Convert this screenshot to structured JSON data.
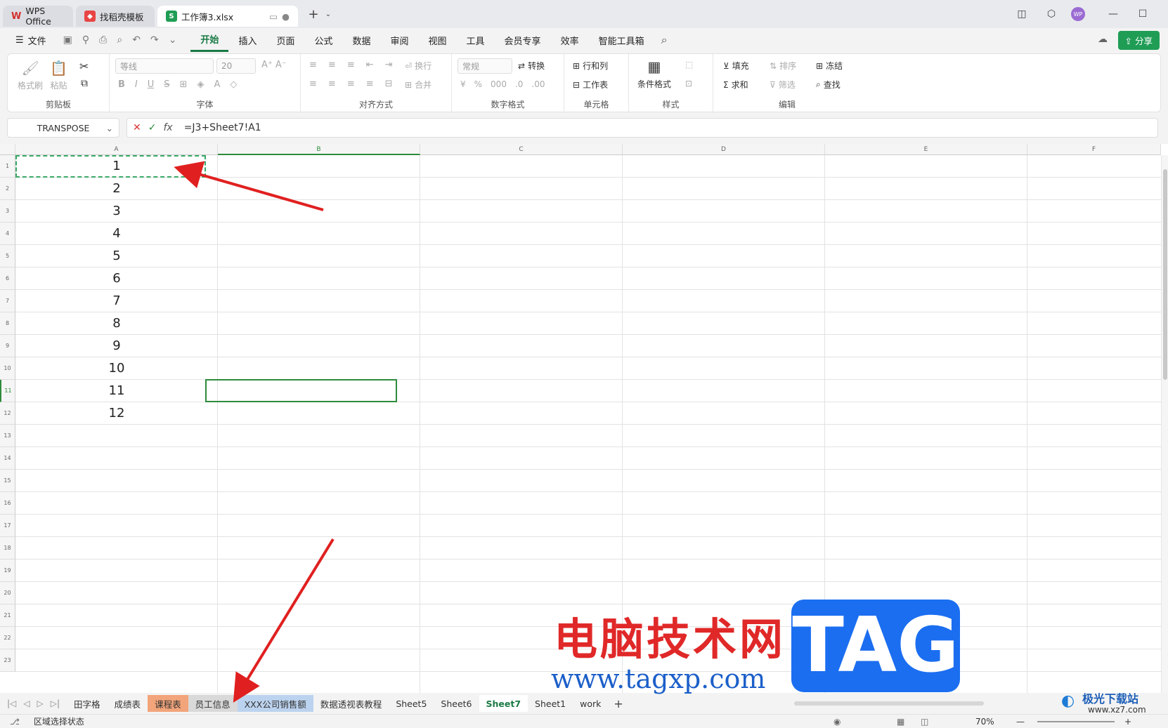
{
  "titlebar": {
    "tabs": [
      {
        "label": "WPS Office",
        "active": false
      },
      {
        "label": "找稻壳模板",
        "active": false
      },
      {
        "label": "工作簿3.xlsx",
        "active": true
      }
    ],
    "new_tab": "+"
  },
  "menu": {
    "file": "文件",
    "items": [
      "开始",
      "插入",
      "页面",
      "公式",
      "数据",
      "审阅",
      "视图",
      "工具",
      "会员专享",
      "效率",
      "智能工具箱"
    ],
    "active": "开始",
    "share": "分享"
  },
  "ribbon": {
    "clipboard": {
      "label": "剪贴板",
      "format_painter": "格式刷",
      "paste": "粘贴"
    },
    "font": {
      "label": "字体",
      "font_name": "等线",
      "font_size": "20"
    },
    "align": {
      "label": "对齐方式",
      "wrap": "换行",
      "merge": "合并"
    },
    "number": {
      "label": "数字格式",
      "format": "常规",
      "convert": "转换"
    },
    "cells": {
      "label": "单元格",
      "rowcol": "行和列",
      "sheet": "工作表"
    },
    "styles": {
      "label": "样式",
      "cond_format": "条件格式"
    },
    "edit": {
      "label": "编辑",
      "fill": "填充",
      "sort": "排序",
      "freeze": "冻结",
      "sum": "求和",
      "filter": "筛选",
      "find": "查找"
    }
  },
  "formula_bar": {
    "name_box": "TRANSPOSE",
    "fx": "fx",
    "formula": "=J3+Sheet7!A1"
  },
  "grid": {
    "columns": [
      "A",
      "B",
      "C",
      "D",
      "E",
      "F"
    ],
    "rows": [
      "1",
      "2",
      "3",
      "4",
      "5",
      "6",
      "7",
      "8",
      "9",
      "10",
      "11",
      "12",
      "13",
      "14",
      "15",
      "16",
      "17",
      "18",
      "19",
      "20",
      "21",
      "22",
      "23"
    ],
    "column_a_values": [
      "1",
      "2",
      "3",
      "4",
      "5",
      "6",
      "7",
      "8",
      "9",
      "10",
      "11",
      "12"
    ],
    "active_cell": "B11",
    "accent": "#2e8b3c"
  },
  "sheets": {
    "tabs": [
      {
        "label": "田字格"
      },
      {
        "label": "成绩表"
      },
      {
        "label": "课程表",
        "color": "#f2a47a"
      },
      {
        "label": "员工信息",
        "color": "#d9d9d9"
      },
      {
        "label": "XXX公司销售额",
        "color": "#bcd3ef"
      },
      {
        "label": "数据透视表教程"
      },
      {
        "label": "Sheet5"
      },
      {
        "label": "Sheet6"
      },
      {
        "label": "Sheet7",
        "active": true
      },
      {
        "label": "Sheet1"
      },
      {
        "label": "work"
      }
    ],
    "add": "+"
  },
  "status": {
    "mode": "区域选择状态",
    "zoom": "70%"
  },
  "watermark": {
    "title": "电脑技术网",
    "url": "www.tagxp.com",
    "badge": "TAG",
    "site": "极光下载站",
    "site_url": "www.xz7.com"
  }
}
